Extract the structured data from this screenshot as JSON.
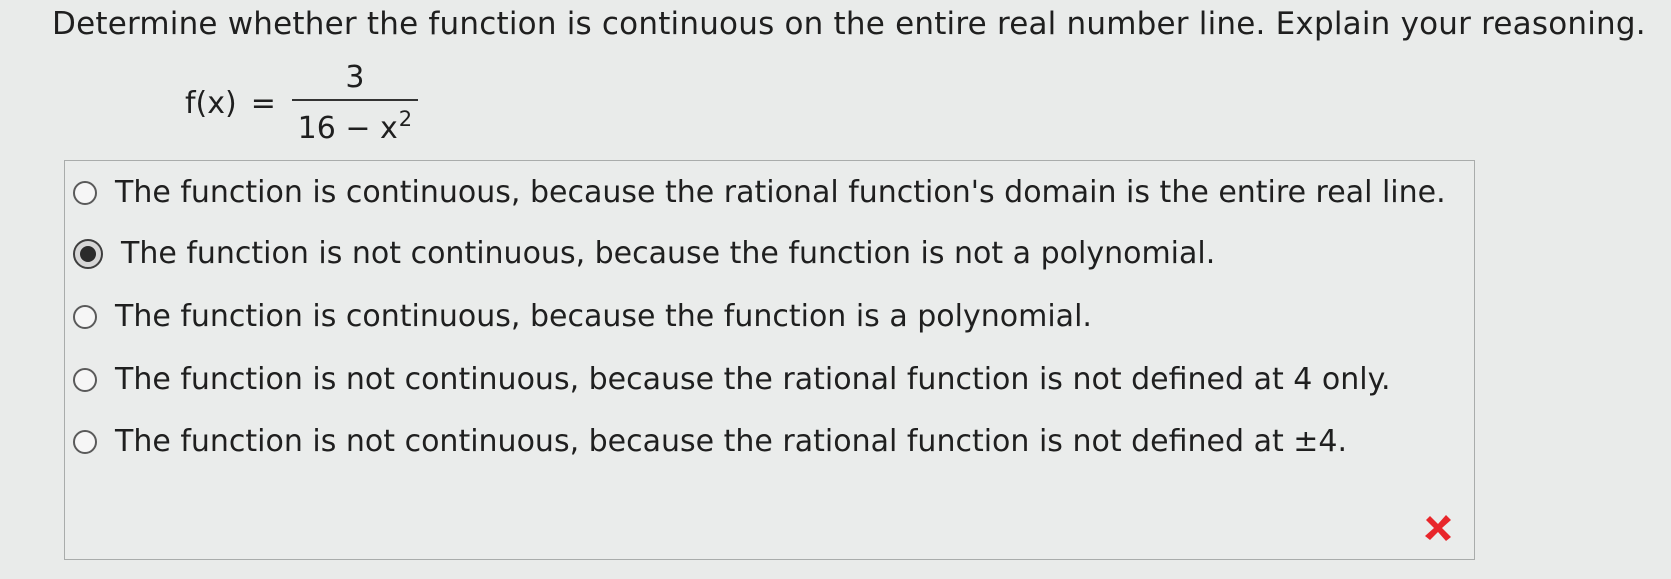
{
  "question": {
    "prompt": "Determine whether the function is continuous on the entire real number line. Explain your reasoning.",
    "formula": {
      "lhs": "f(x)",
      "eq": "=",
      "numerator": "3",
      "denominator_base": "16 − x",
      "denominator_exp": "2"
    }
  },
  "choices": [
    {
      "label": "The function is continuous, because the rational function's domain is the entire real line.",
      "selected": false
    },
    {
      "label": "The function is not continuous, because the function is not a polynomial.",
      "selected": true
    },
    {
      "label": "The function is continuous, because the function is a polynomial.",
      "selected": false
    },
    {
      "label": "The function is not continuous, because the rational function is not defined at 4 only.",
      "selected": false
    },
    {
      "label": "The function is not continuous, because the rational function is not defined at ±4.",
      "selected": false
    }
  ],
  "feedback": {
    "icon": "x-mark-icon",
    "color": "#e8262b"
  }
}
